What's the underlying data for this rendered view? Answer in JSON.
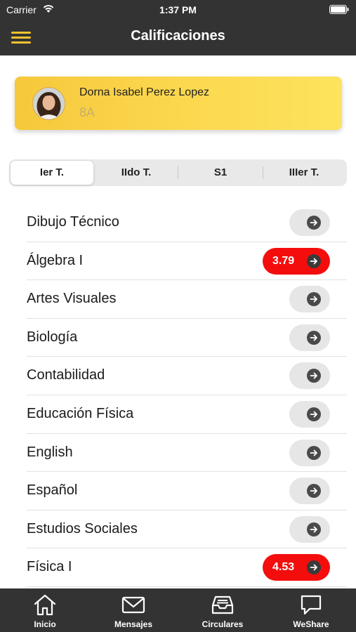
{
  "status_bar": {
    "carrier": "Carrier",
    "time": "1:37 PM"
  },
  "nav": {
    "title": "Calificaciones"
  },
  "student": {
    "name": "Dorna Isabel Perez Lopez",
    "group": "8A"
  },
  "terms": [
    {
      "label": "Ier T.",
      "selected": true
    },
    {
      "label": "IIdo T.",
      "selected": false
    },
    {
      "label": "S1",
      "selected": false
    },
    {
      "label": "IIIer T.",
      "selected": false
    }
  ],
  "subjects": [
    {
      "name": "Dibujo Técnico",
      "grade": ""
    },
    {
      "name": "Álgebra I",
      "grade": "3.79"
    },
    {
      "name": "Artes Visuales",
      "grade": ""
    },
    {
      "name": "Biología",
      "grade": ""
    },
    {
      "name": "Contabilidad",
      "grade": ""
    },
    {
      "name": "Educación Física",
      "grade": ""
    },
    {
      "name": "English",
      "grade": ""
    },
    {
      "name": "Español",
      "grade": ""
    },
    {
      "name": "Estudios Sociales",
      "grade": ""
    },
    {
      "name": "Física I",
      "grade": "4.53"
    }
  ],
  "tab_bar": {
    "items": [
      {
        "label": "Inicio",
        "icon": "home-icon"
      },
      {
        "label": "Mensajes",
        "icon": "envelope-icon"
      },
      {
        "label": "Circulares",
        "icon": "inbox-tray-icon"
      },
      {
        "label": "WeShare",
        "icon": "chat-bubble-icon"
      }
    ]
  },
  "colors": {
    "header_bg": "#333333",
    "menu_accent": "#f2c230",
    "card_gradient_start": "#f6c83b",
    "card_gradient_end": "#fde35e",
    "failing_grade": "#f40d0d",
    "pill_neutral": "#e6e6e6"
  }
}
